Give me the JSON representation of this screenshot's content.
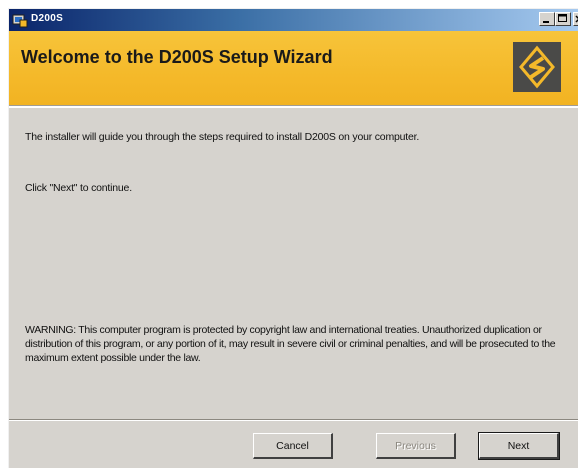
{
  "window": {
    "title": "D200S",
    "controls": {
      "minimize_icon": "minimize-icon",
      "maximize_icon": "maximize-icon",
      "close_icon": "close-icon"
    }
  },
  "banner": {
    "title": "Welcome to the D200S Setup Wizard",
    "logo_icon": "s-logo-icon",
    "background_color": "#f4b92a",
    "logo_color": "#4a4a48"
  },
  "content": {
    "intro": "The installer will guide you through the steps required to install D200S on your computer.",
    "continue_hint": "Click \"Next\" to continue.",
    "warning": "WARNING: This computer program is protected by copyright law and international treaties. Unauthorized duplication or distribution of this program, or any portion of it, may result in severe civil or criminal penalties, and will be prosecuted to the maximum extent possible under the law."
  },
  "buttons": {
    "cancel": "Cancel",
    "previous": "Previous",
    "next": "Next"
  }
}
